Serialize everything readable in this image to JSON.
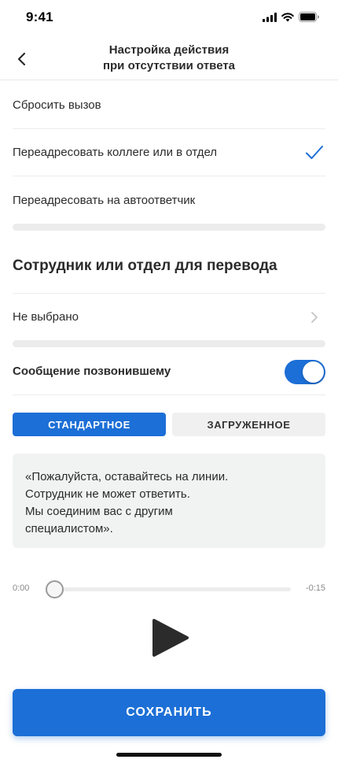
{
  "status_bar": {
    "time": "9:41"
  },
  "header": {
    "title_line1": "Настройка действия",
    "title_line2": "при отсутствии ответа"
  },
  "options": [
    {
      "label": "Сбросить вызов",
      "selected": false
    },
    {
      "label": "Переадресовать коллеге или в отдел",
      "selected": true
    },
    {
      "label": "Переадресовать на автоответчик",
      "selected": false
    }
  ],
  "transfer_section": {
    "title": "Сотрудник или отдел для перевода",
    "value": "Не выбрано"
  },
  "caller_message": {
    "label": "Сообщение позвонившему",
    "enabled": true
  },
  "message_tabs": {
    "standard": "СТАНДАРТНОЕ",
    "uploaded": "ЗАГРУЖЕННОЕ",
    "active": "standard"
  },
  "message_text": {
    "line1": "«Пожалуйста, оставайтесь на линии.",
    "line2": "Сотрудник не может ответить.",
    "line3": "Мы соединим вас с другим",
    "line4": "специалистом»."
  },
  "player": {
    "elapsed": "0:00",
    "remaining": "-0:15",
    "progress": 0
  },
  "save_button": {
    "label": "СОХРАНИТЬ"
  },
  "colors": {
    "accent": "#1c6fd6",
    "separator": "#ececec",
    "text": "#2b2b2b"
  }
}
